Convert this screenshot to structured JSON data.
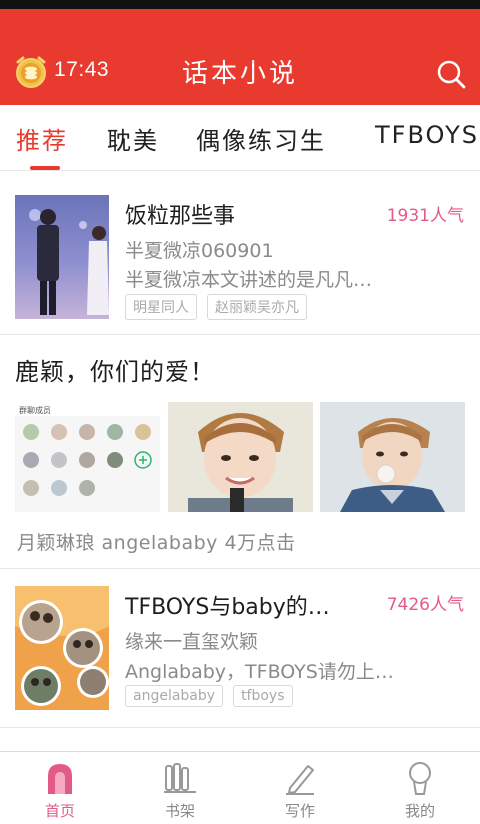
{
  "app": {
    "time": "17:43",
    "title": "话本小说"
  },
  "tabs": [
    {
      "label": "推荐"
    },
    {
      "label": "耽美"
    },
    {
      "label": "偶像练习生"
    },
    {
      "label": "TFBOYS"
    }
  ],
  "feed": {
    "book1": {
      "title": "饭粒那些事",
      "popularity": "1931人气",
      "author": "半夏微凉060901",
      "desc": "半夏微凉本文讲述的是凡凡…",
      "tags": [
        "明星同人",
        "赵丽颖吴亦凡"
      ]
    },
    "post": {
      "title": "鹿颖，你们的爱！",
      "meta": "月颖琳琅 angelababy 4万点击",
      "thumb_header": "群聊成员"
    },
    "book2": {
      "title": "TFBOYS与baby的…",
      "popularity": "7426人气",
      "author": "缘来一直玺欢颖",
      "desc": "Anglababy，TFBOYS请勿上…",
      "tags": [
        "angelababy",
        "tfboys"
      ]
    }
  },
  "nav": [
    {
      "label": "首页"
    },
    {
      "label": "书架"
    },
    {
      "label": "写作"
    },
    {
      "label": "我的"
    }
  ],
  "colors": {
    "brand_red": "#e83a2e",
    "accent_pink": "#e45a86"
  }
}
